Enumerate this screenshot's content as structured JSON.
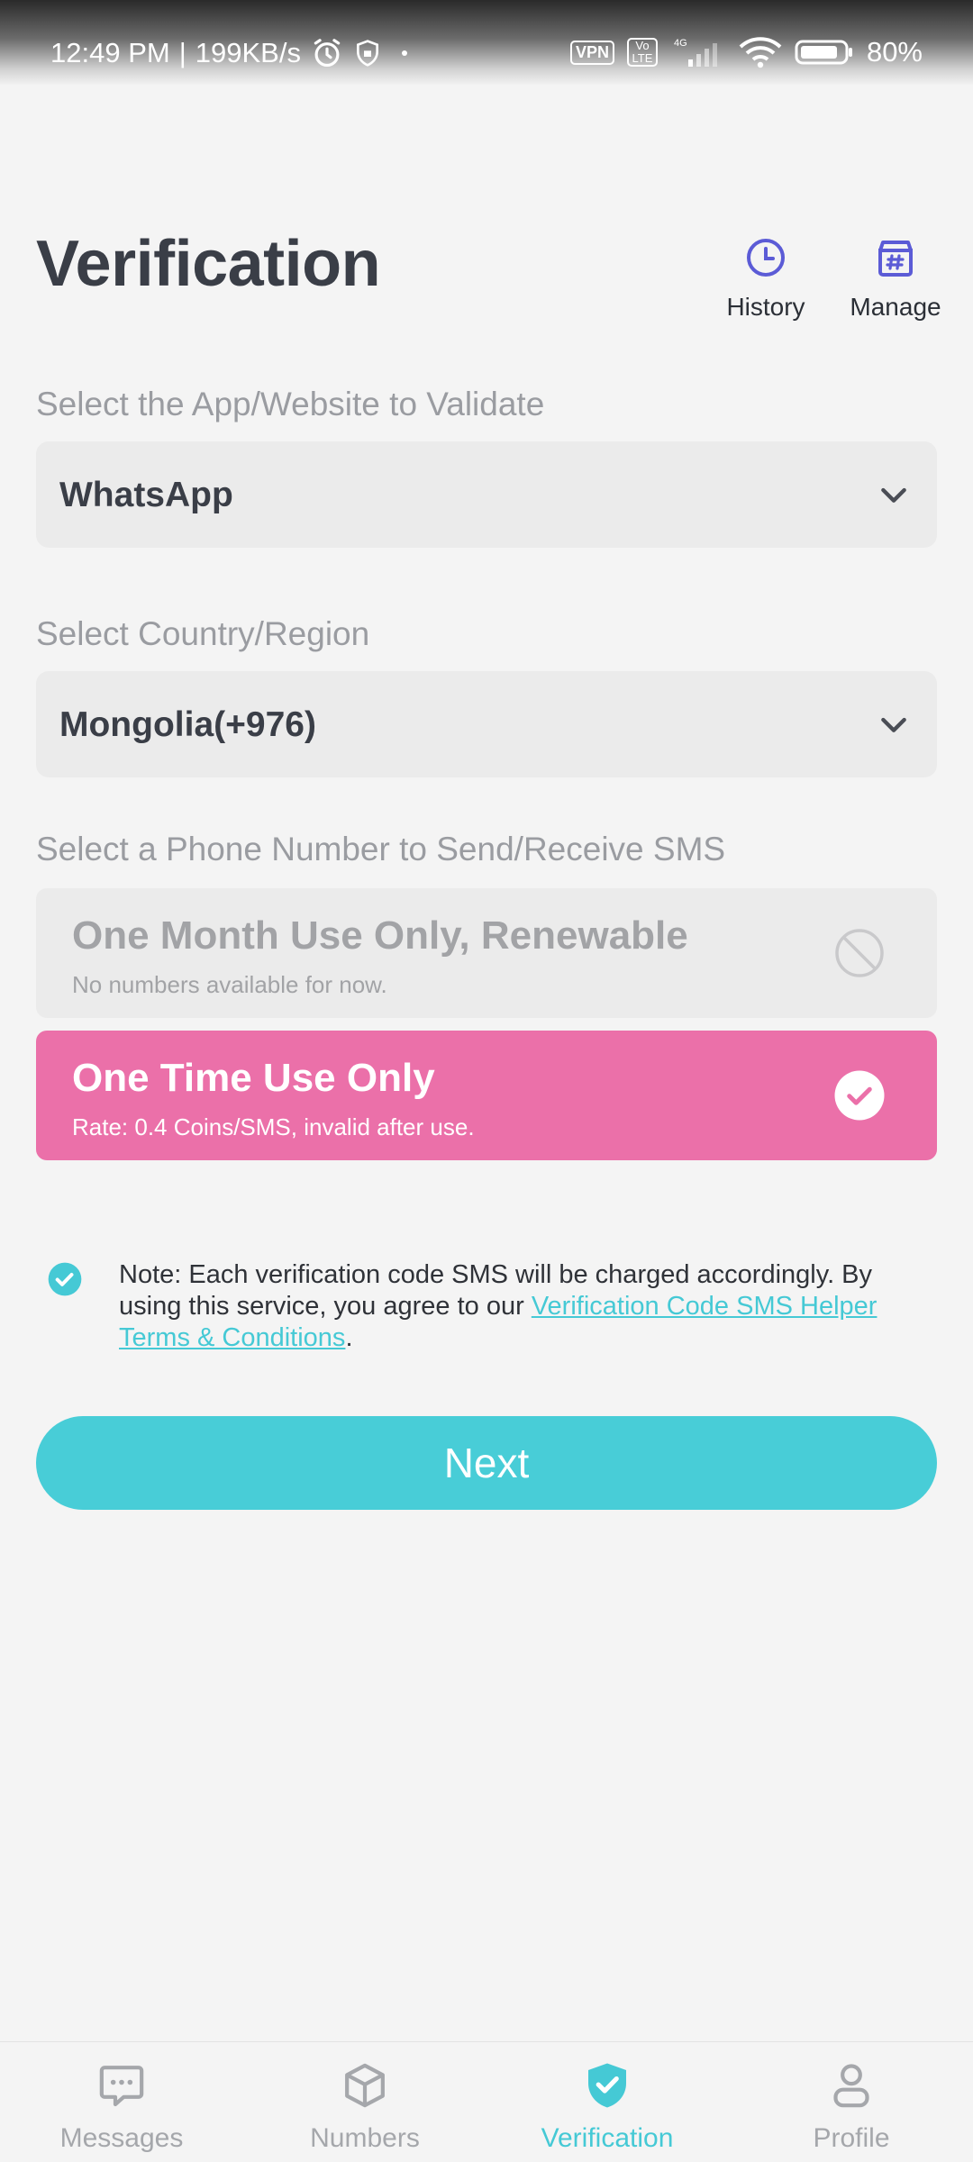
{
  "status_bar": {
    "time": "12:49 PM",
    "separator": "|",
    "net_speed": "199KB/s",
    "vpn": "VPN",
    "volte": "Vo LTE",
    "network": "4G",
    "battery": "80%"
  },
  "header": {
    "title": "Verification",
    "history_label": "History",
    "manage_label": "Manage"
  },
  "app_select": {
    "label": "Select the App/Website to Validate",
    "value": "WhatsApp"
  },
  "country_select": {
    "label": "Select Country/Region",
    "value": "Mongolia(+976)"
  },
  "phone_section": {
    "label": "Select a Phone Number to Send/Receive SMS",
    "options": [
      {
        "title": "One Month Use Only, Renewable",
        "subtitle": "No numbers available for now.",
        "state": "disabled"
      },
      {
        "title": "One Time Use Only",
        "subtitle": "Rate: 0.4 Coins/SMS, invalid after use.",
        "state": "selected"
      }
    ]
  },
  "note": {
    "text": "Note: Each verification code SMS will be charged accordingly. By using this service, you agree to our ",
    "link_text": "Verification Code SMS Helper Terms & Conditions",
    "end": ".",
    "checked": true
  },
  "next_button": {
    "label": "Next"
  },
  "bottom_nav": {
    "items": [
      {
        "label": "Messages",
        "icon": "message-bubble-icon"
      },
      {
        "label": "Numbers",
        "icon": "box-icon"
      },
      {
        "label": "Verification",
        "icon": "shield-check-icon",
        "active": true
      },
      {
        "label": "Profile",
        "icon": "person-icon"
      }
    ]
  },
  "colors": {
    "accent": "#48cdd7",
    "selected_option": "#eb70a9",
    "header_icon": "#5b5bd6",
    "inactive_nav": "#a5a7ab"
  }
}
